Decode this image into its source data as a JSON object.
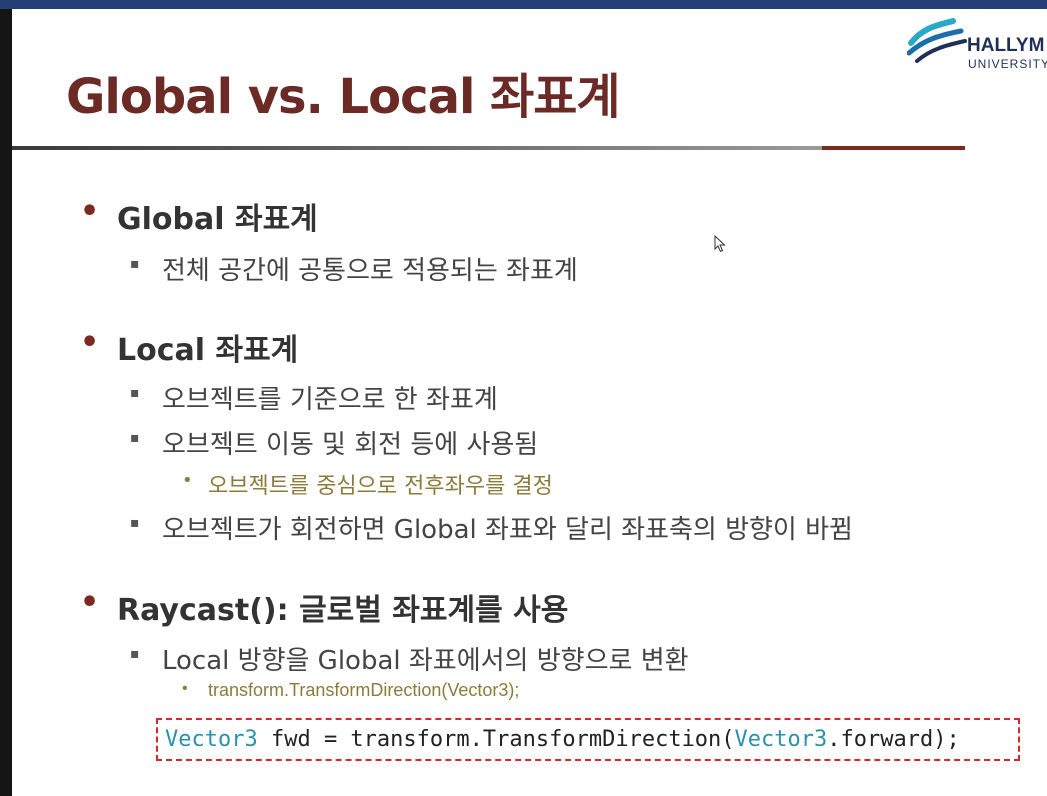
{
  "slide": {
    "title": "Global vs. Local 좌표계",
    "logo": {
      "name": "HALLYM",
      "sub": "UNIVERSITY"
    },
    "bullet_glyph": "•",
    "sub_bullet_glyph": "▪",
    "sections": [
      {
        "heading": "Global 좌표계",
        "items": [
          "전체 공간에 공통으로 적용되는 좌표계"
        ]
      },
      {
        "heading": "Local 좌표계",
        "items": [
          "오브젝트를 기준으로 한 좌표계",
          "오브젝트 이동 및 회전 등에 사용됨",
          "오브젝트가 회전하면 Global 좌표와 달리 좌표축의 방향이 바뀜"
        ],
        "sub_items": [
          "오브젝트를 중심으로 전후좌우를 결정"
        ]
      },
      {
        "heading": "Raycast(): 글로벌 좌표계를 사용",
        "items": [
          "Local 방향을 Global 좌표에서의 방향으로 변환"
        ],
        "sub_items": [
          "transform.TransformDirection(Vector3);"
        ]
      }
    ],
    "code": {
      "t1": "Vector3",
      "t2": " fwd = transform.TransformDirection(",
      "t3": "Vector3",
      "t4": ".forward);"
    }
  },
  "colors": {
    "title": "#6b2a25",
    "accent_rule": "#7b2a22",
    "sub_bullet_text": "#8c7b3a",
    "code_type": "#2b91af",
    "code_border": "#d22a2a"
  }
}
